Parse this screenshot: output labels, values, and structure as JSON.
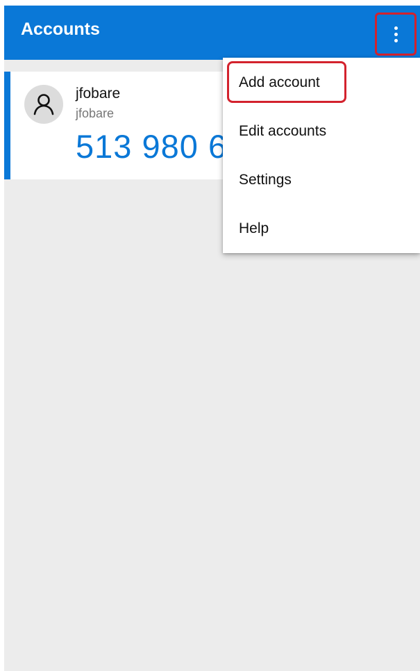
{
  "appbar": {
    "title": "Accounts",
    "overflow_icon": "more-vert-icon"
  },
  "account": {
    "name": "jfobare",
    "email": "jfobare",
    "code": "513 980 6",
    "avatar_icon": "person-icon"
  },
  "menu": {
    "items": [
      {
        "label": "Add account",
        "highlighted": true
      },
      {
        "label": "Edit accounts",
        "highlighted": false
      },
      {
        "label": "Settings",
        "highlighted": false
      },
      {
        "label": "Help",
        "highlighted": false
      }
    ]
  },
  "colors": {
    "primary": "#0a78d7",
    "highlight_border": "#d3222d",
    "background": "#ececec"
  }
}
